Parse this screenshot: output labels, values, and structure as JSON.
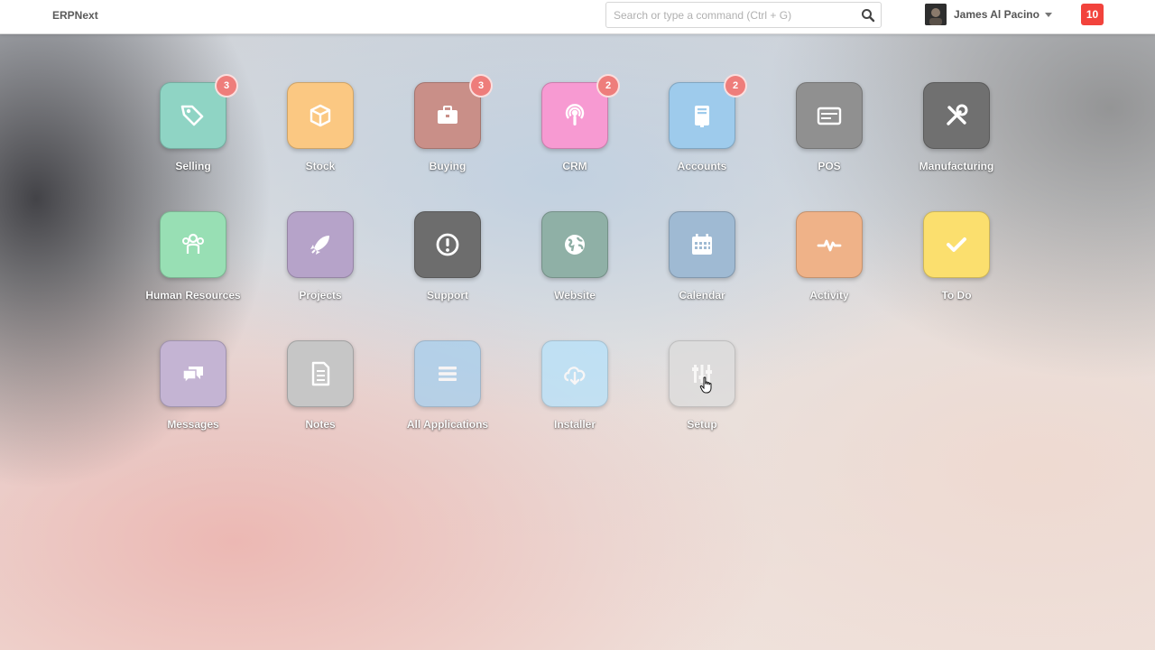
{
  "navbar": {
    "brand": "ERPNext",
    "search_placeholder": "Search or type a command (Ctrl + G)",
    "user_name": "James Al Pacino",
    "notification_count": "10"
  },
  "apps": [
    {
      "label": "Selling",
      "badge": "3",
      "color": "#8fd4c4",
      "icon": "tag-icon"
    },
    {
      "label": "Stock",
      "badge": "",
      "color": "#fbc882",
      "icon": "box-icon"
    },
    {
      "label": "Buying",
      "badge": "3",
      "color": "#c98f88",
      "icon": "briefcase-icon"
    },
    {
      "label": "CRM",
      "badge": "2",
      "color": "#f79ad2",
      "icon": "podcast-icon"
    },
    {
      "label": "Accounts",
      "badge": "2",
      "color": "#9ecbec",
      "icon": "book-icon"
    },
    {
      "label": "POS",
      "badge": "",
      "color": "#909090",
      "icon": "credit-card-icon"
    },
    {
      "label": "Manufacturing",
      "badge": "",
      "color": "#707070",
      "icon": "wrench-icon"
    },
    {
      "label": "Human Resources",
      "badge": "",
      "color": "#98dfb4",
      "icon": "users-icon"
    },
    {
      "label": "Projects",
      "badge": "",
      "color": "#b6a3c9",
      "icon": "rocket-icon"
    },
    {
      "label": "Support",
      "badge": "",
      "color": "#6d6d6d",
      "icon": "exclamation-icon"
    },
    {
      "label": "Website",
      "badge": "",
      "color": "#8fb0a6",
      "icon": "globe-icon"
    },
    {
      "label": "Calendar",
      "badge": "",
      "color": "#9fbad3",
      "icon": "calendar-icon"
    },
    {
      "label": "Activity",
      "badge": "",
      "color": "#efb288",
      "icon": "pulse-icon"
    },
    {
      "label": "To Do",
      "badge": "",
      "color": "#fbdf6e",
      "icon": "check-icon"
    },
    {
      "label": "Messages",
      "badge": "",
      "color": "#c4b4d3",
      "icon": "comments-icon"
    },
    {
      "label": "Notes",
      "badge": "",
      "color": "#c6c6c6",
      "icon": "file-icon"
    },
    {
      "label": "All Applications",
      "badge": "",
      "color": "#a6cfee",
      "icon": "list-icon"
    },
    {
      "label": "Installer",
      "badge": "",
      "color": "#b6e2fb",
      "icon": "cloud-download-icon"
    },
    {
      "label": "Setup",
      "badge": "",
      "color": "#dcdcdc",
      "icon": "sliders-icon"
    }
  ]
}
